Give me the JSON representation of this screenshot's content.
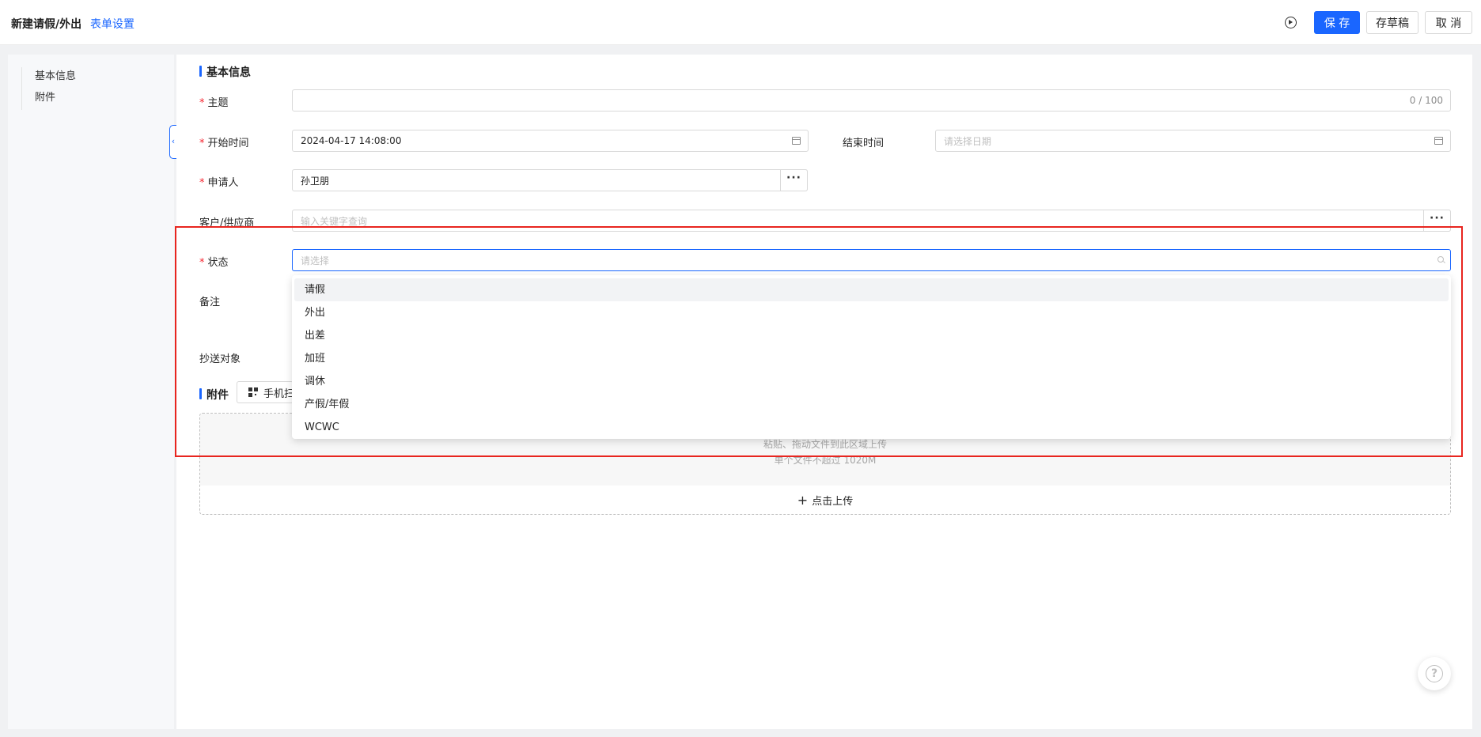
{
  "header": {
    "title": "新建请假/外出",
    "form_settings": "表单设置",
    "save": "保 存",
    "draft": "存草稿",
    "cancel": "取 消"
  },
  "sidebar": {
    "items": [
      {
        "label": "基本信息"
      },
      {
        "label": "附件"
      }
    ]
  },
  "form": {
    "section_basic": "基本信息",
    "subject": {
      "label": "主题",
      "value": "",
      "counter": "0 / 100"
    },
    "start_time": {
      "label": "开始时间",
      "value": "2024-04-17 14:08:00"
    },
    "end_time": {
      "label": "结束时间",
      "placeholder": "请选择日期"
    },
    "applicant": {
      "label": "申请人",
      "value": "孙卫朋"
    },
    "customer": {
      "label": "客户/供应商",
      "placeholder": "输入关键字查询"
    },
    "status": {
      "label": "状态",
      "placeholder": "请选择"
    },
    "remark": {
      "label": "备注"
    },
    "cc": {
      "label": "抄送对象"
    },
    "more_symbol": "···"
  },
  "attachments": {
    "section_title": "附件",
    "scan_button": "手机扫",
    "drop_hint": "粘贴、拖动文件到此区域上传",
    "size_hint": "单个文件不超过 1020M",
    "upload_button": "点击上传"
  },
  "status_dropdown": {
    "options": [
      "请假",
      "外出",
      "出差",
      "加班",
      "调休",
      "产假/年假",
      "WCWC"
    ],
    "highlighted_index": 0
  },
  "help": {
    "label": "?"
  },
  "colors": {
    "primary": "#1a66ff",
    "required": "#f5222d",
    "highlight_box": "#e8251f"
  }
}
